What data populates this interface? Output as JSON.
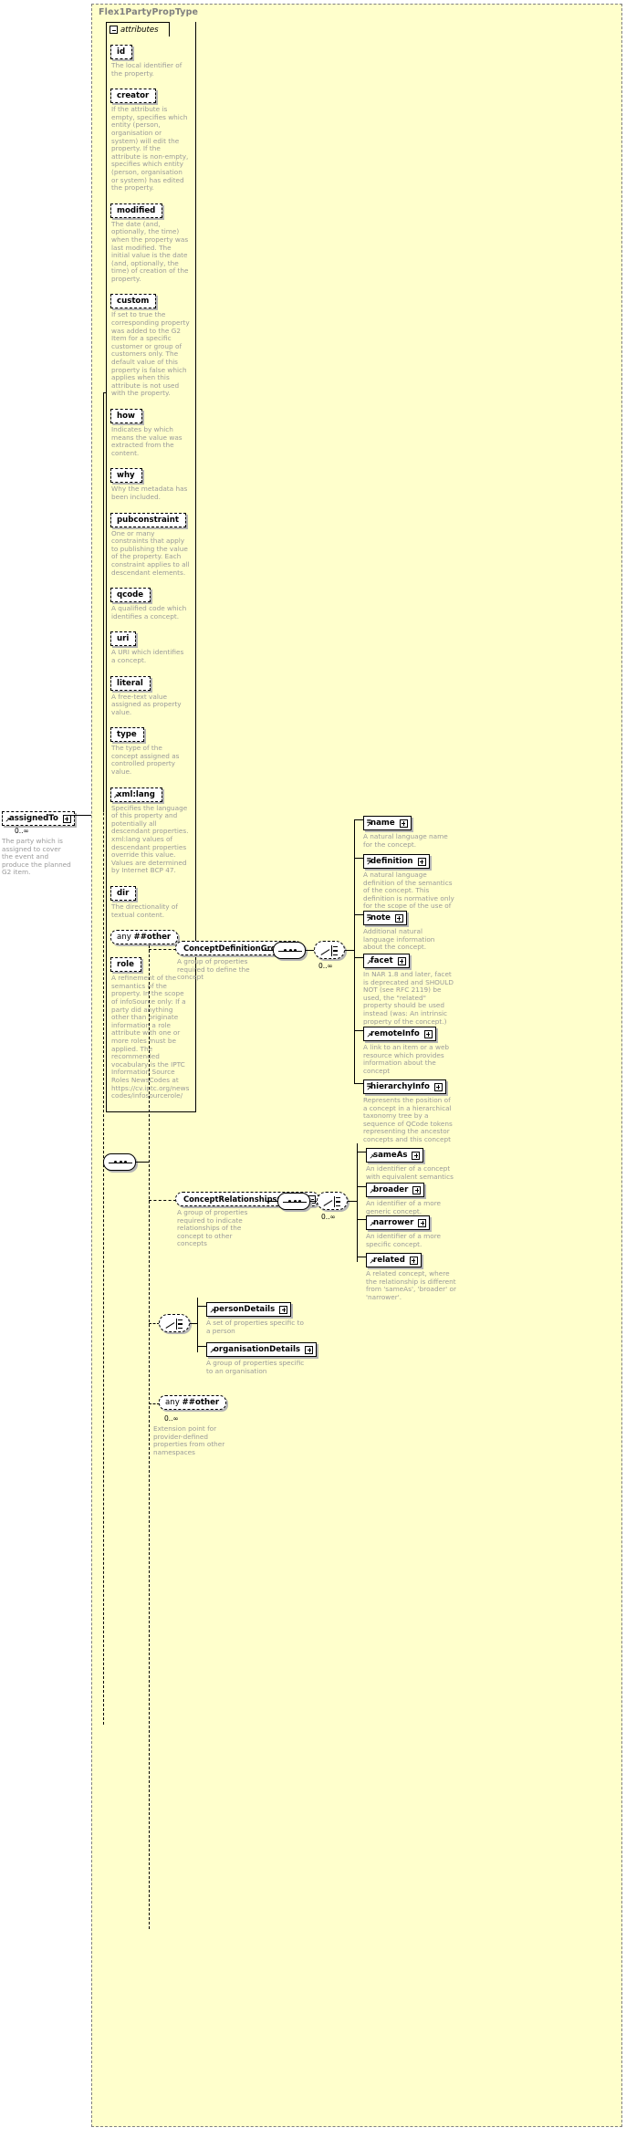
{
  "diagram": {
    "type_name": "Flex1PartyPropType",
    "attributes_label": "attributes",
    "occurs_zero_inf": "0..∞"
  },
  "attributes": [
    {
      "name": "id",
      "desc": "The local identifier of the property."
    },
    {
      "name": "creator",
      "desc": "If the attribute is empty, specifies which entity (person, organisation or system) will edit the property. If the attribute is non-empty, specifies which entity (person, organisation or system) has edited the property."
    },
    {
      "name": "modified",
      "desc": "The date (and, optionally, the time) when the property was last modified. The initial value is the date (and, optionally, the time) of creation of the property."
    },
    {
      "name": "custom",
      "desc": "If set to true the corresponding property was added to the G2 Item for a specific customer or group of customers only. The default value of this property is false which applies when this attribute is not used with the property."
    },
    {
      "name": "how",
      "desc": "Indicates by which means the value was extracted from the content."
    },
    {
      "name": "why",
      "desc": "Why the metadata has been included."
    },
    {
      "name": "pubconstraint",
      "desc": "One or many constraints that apply to publishing the value of the property. Each constraint applies to all descendant elements."
    },
    {
      "name": "qcode",
      "desc": "A qualified code which identifies a concept."
    },
    {
      "name": "uri",
      "desc": "A URI which identifies a concept."
    },
    {
      "name": "literal",
      "desc": "A free-text value assigned as property value."
    },
    {
      "name": "type",
      "desc": "The type of the concept assigned as controlled property value."
    },
    {
      "name": "xml:lang",
      "desc": "Specifies the language of this property and potentially all descendant properties. xml:lang values of descendant properties override this value. Values are determined by Internet BCP 47."
    },
    {
      "name": "dir",
      "desc": "The directionality of textual content."
    },
    {
      "name": "any ##other",
      "desc": ""
    },
    {
      "name": "role",
      "desc": "A refinement of the semantics of the property. In the scope of infoSource only: If a party did anything other than originate information a role attribute with one or more roles must be applied. The recommended vocabulary is the IPTC Information Source Roles NewsCodes at https://cv.iptc.org/newscodes/infosourcerole/"
    }
  ],
  "root_element": {
    "name": "assignedTo",
    "occurs": "0..∞",
    "desc": "The party which is assigned to cover the event and produce the planned G2 item."
  },
  "groups": {
    "concept_definition": {
      "name": "ConceptDefinitionGroup",
      "desc": "A group of properties required to define the concept",
      "occurs": "0..∞"
    },
    "concept_relationships": {
      "name": "ConceptRelationshipsGroup",
      "desc": "A group of properties required to indicate relationships of the concept to other concepts",
      "occurs": "0..∞"
    }
  },
  "definition_elements": [
    {
      "name": "name",
      "desc": "A natural language name for the concept."
    },
    {
      "name": "definition",
      "desc": "A natural language definition of the semantics of the concept. This definition is normative only for the scope of the use of this concept."
    },
    {
      "name": "note",
      "desc": "Additional natural language information about the concept."
    },
    {
      "name": "facet",
      "desc": "In NAR 1.8 and later, facet is deprecated and SHOULD NOT (see RFC 2119) be used, the \"related\" property should be used instead (was: An intrinsic property of the concept.)"
    },
    {
      "name": "remoteInfo",
      "desc": "A link to an item or a web resource which provides information about the concept"
    },
    {
      "name": "hierarchyInfo",
      "desc": "Represents the position of a concept in a hierarchical taxonomy tree by a sequence of QCode tokens representing the ancestor concepts and this concept"
    }
  ],
  "relationship_elements": [
    {
      "name": "sameAs",
      "desc": "An identifier of a concept with equivalent semantics"
    },
    {
      "name": "broader",
      "desc": "An identifier of a more generic concept."
    },
    {
      "name": "narrower",
      "desc": "An identifier of a more specific concept."
    },
    {
      "name": "related",
      "desc": "A related concept, where the relationship is different from 'sameAs', 'broader' or 'narrower'."
    }
  ],
  "detail_elements": [
    {
      "name": "personDetails",
      "desc": "A set of properties specific to a person"
    },
    {
      "name": "organisationDetails",
      "desc": "A group of properties specific to an organisation"
    }
  ],
  "extension": {
    "name": "any ##other",
    "any_prefix": "any",
    "any_suffix": "##other",
    "occurs": "0..∞",
    "desc": "Extension point for provider-defined properties from other namespaces"
  },
  "colors": {
    "background": "#ffffcc",
    "description_text": "#9a9a9a",
    "title_text": "#808080",
    "line": "#000000",
    "shadow": "#b5b5b5"
  }
}
